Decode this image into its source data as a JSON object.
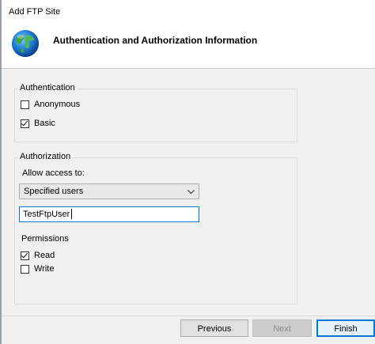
{
  "window": {
    "title": "Add FTP Site"
  },
  "header": {
    "title": "Authentication and Authorization Information",
    "icon": "globe-icon"
  },
  "authentication": {
    "group_label": "Authentication",
    "options": [
      {
        "label": "Anonymous",
        "checked": false
      },
      {
        "label": "Basic",
        "checked": true
      }
    ]
  },
  "authorization": {
    "group_label": "Authorization",
    "allow_access_label": "Allow access to:",
    "allow_access_selected": "Specified users",
    "users_value": "TestFtpUser",
    "permissions_label": "Permissions",
    "permissions": [
      {
        "label": "Read",
        "checked": true
      },
      {
        "label": "Write",
        "checked": false
      }
    ]
  },
  "buttons": {
    "previous": "Previous",
    "next": "Next",
    "finish": "Finish",
    "next_enabled": false
  },
  "colors": {
    "accent": "#0078d7",
    "header_bg": "#ffffff",
    "dialog_bg": "#f0f0f0"
  }
}
